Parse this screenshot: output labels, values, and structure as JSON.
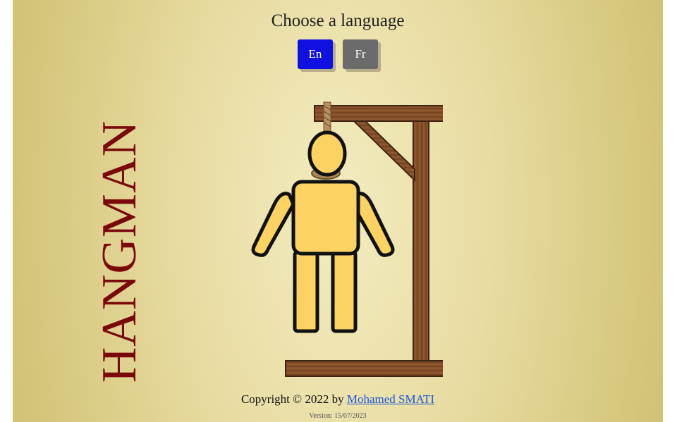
{
  "language": {
    "title": "Choose a language",
    "buttons": [
      {
        "label": "En",
        "color": "#1010e0"
      },
      {
        "label": "Fr",
        "color": "#6b6b6b"
      }
    ]
  },
  "side_title": "HANGMAN",
  "footer": {
    "copyright_prefix": "Copyright © 2022 by",
    "author": "Mohamed SMATI",
    "version": "Version: 15/07/2023"
  },
  "colors": {
    "title": "#7a0a0a",
    "wood": "#7c4a25",
    "figure_fill": "#fcd362",
    "link": "#1a56d6"
  }
}
